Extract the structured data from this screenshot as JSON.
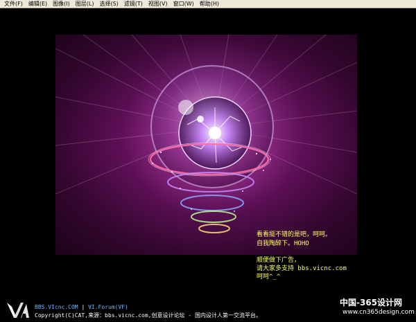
{
  "menu": {
    "items": [
      "文件(F)",
      "编辑(E)",
      "图像(I)",
      "图层(L)",
      "选择(S)",
      "滤镜(T)",
      "视图(V)",
      "窗口(W)",
      "帮助(H)"
    ]
  },
  "notes": {
    "line1": "看看挺不错的是吧，呵呵。",
    "line2": "自我陶醉下。HOHO",
    "line3": "顺便做下广告，",
    "line4": "请大家多支持 bbs.vicnc.com",
    "line5": "呵呵^_^"
  },
  "footer": {
    "line1a": "BBS.VIcnc.COM",
    "separator": "|",
    "line1b": "VI.Forum(VF)",
    "line2": "Copyright(C)CAT,来源：bbs.vicnc.com,创意设计论坛 - 国内设计人第一交流平台。",
    "link_color": "#6fb7ff",
    "text_color": "#ffffff"
  },
  "watermark": {
    "text": "中国-365设计网",
    "url": "www.cn365design.com"
  },
  "colors": {
    "canvas_center": "#c04cae",
    "canvas_edge": "#1c0319",
    "note_text": "#ffff66"
  }
}
